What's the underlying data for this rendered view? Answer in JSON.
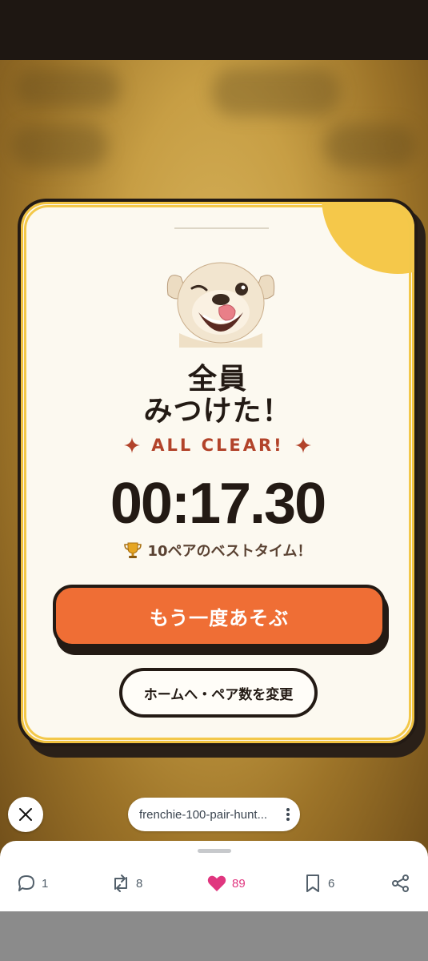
{
  "popup": {
    "title_line1": "全員",
    "title_line2": "みつけた！",
    "subtitle": "ALL CLEAR!",
    "time": "00:17.30",
    "best_time_message": "10ペアのベストタイム！",
    "replay_button": "もう一度あそぶ",
    "home_button": "ホームへ・ペア数を変更"
  },
  "overlay": {
    "url": "frenchie-100-pair-hunt..."
  },
  "actions": {
    "replies": "1",
    "reposts": "8",
    "likes": "89",
    "bookmarks": "6"
  },
  "colors": {
    "accent": "#ef6e35",
    "subtitle": "#b2432a",
    "card_bg": "#fcf9f0",
    "corner": "#f5c84a",
    "like": "#e0367f"
  },
  "icons": [
    "sparkle-icon",
    "trophy-icon",
    "close-icon",
    "more-icon",
    "reply-icon",
    "repost-icon",
    "heart-icon",
    "bookmark-icon",
    "share-icon"
  ]
}
